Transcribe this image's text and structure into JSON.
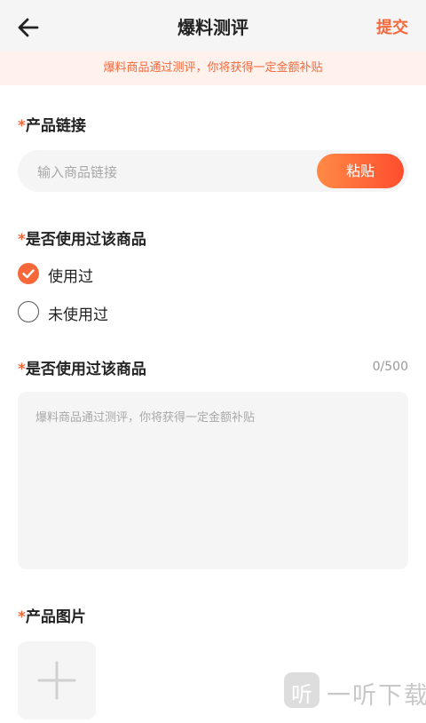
{
  "header": {
    "title": "爆料测评",
    "submit_label": "提交"
  },
  "notice": "爆料商品通过测评，你将获得一定金额补贴",
  "product_link": {
    "required_mark": "*",
    "label": "产品链接",
    "placeholder": "输入商品链接",
    "paste_label": "粘贴"
  },
  "usage": {
    "required_mark": "*",
    "label": "是否使用过该商品",
    "options": [
      {
        "label": "使用过",
        "selected": true
      },
      {
        "label": "未使用过",
        "selected": false
      }
    ]
  },
  "review": {
    "required_mark": "*",
    "label": "是否使用过该商品",
    "counter": "0/500",
    "placeholder": "爆料商品通过测评，你将获得一定金额补贴"
  },
  "images": {
    "required_mark": "*",
    "label": "产品图片"
  },
  "watermark": {
    "icon": "听",
    "text": "一听下载"
  },
  "colors": {
    "accent": "#f6683a",
    "notice_bg": "#fff1ec",
    "field_bg": "#f5f5f5"
  }
}
